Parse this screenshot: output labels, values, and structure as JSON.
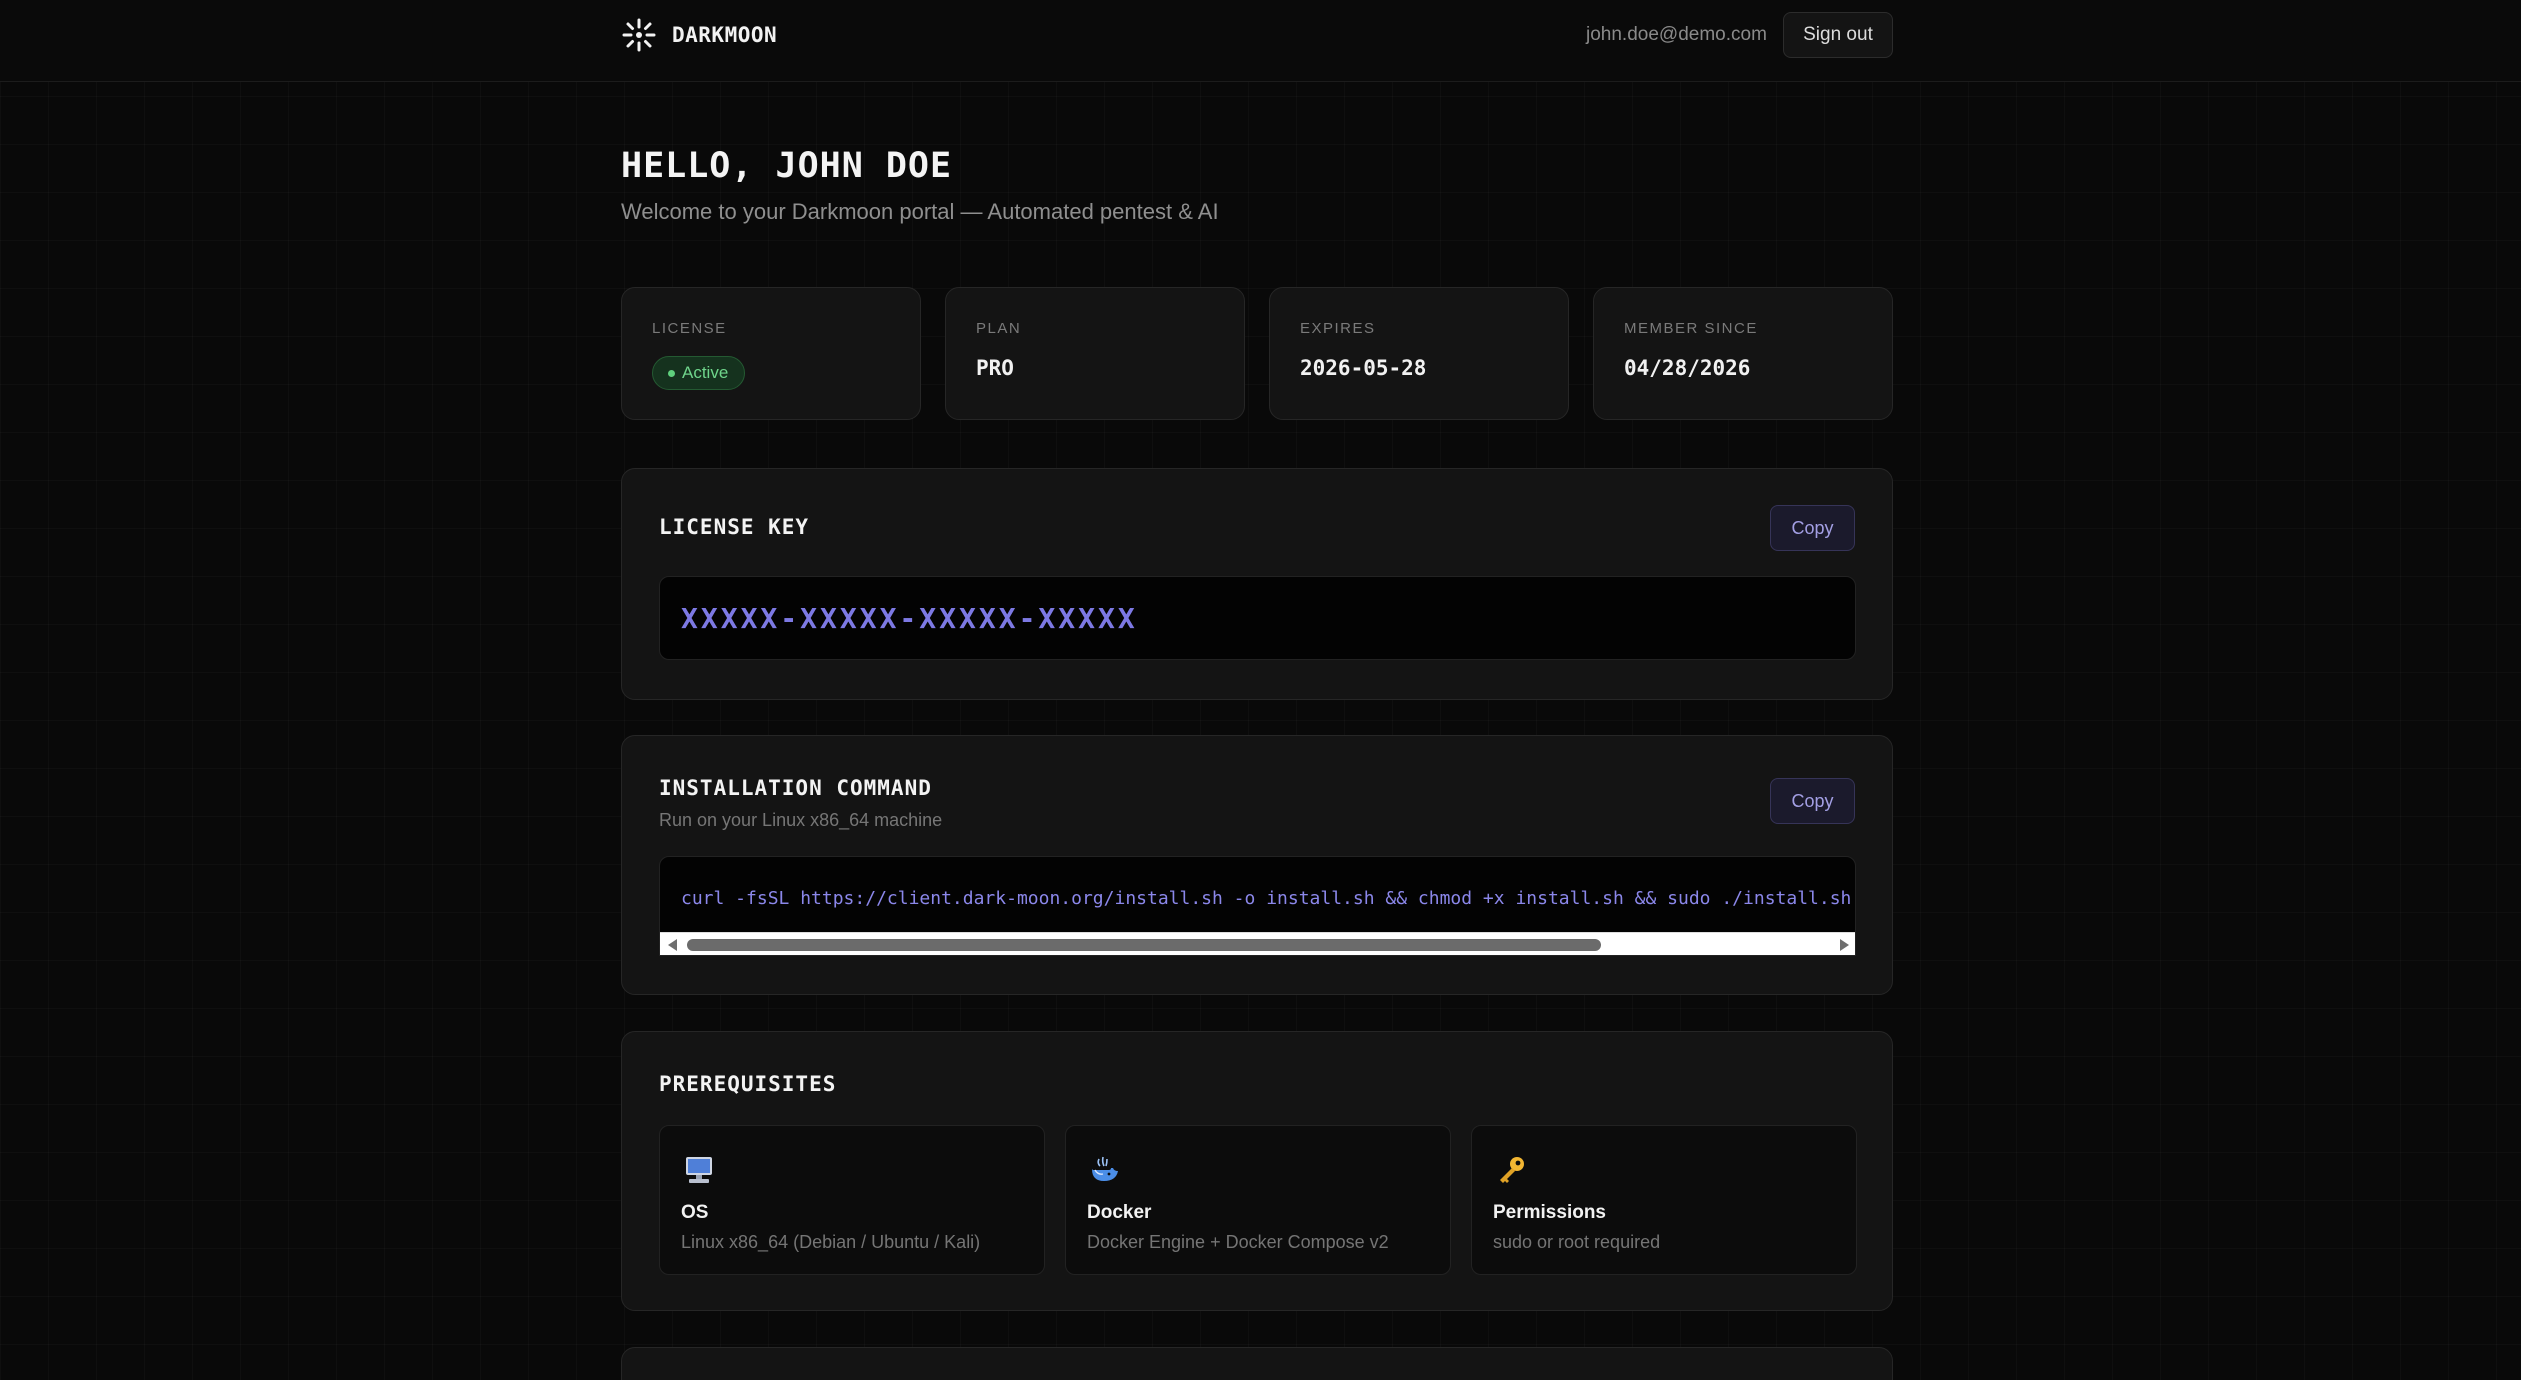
{
  "header": {
    "brand": "DARKMOON",
    "user_email": "john.doe@demo.com",
    "sign_out": "Sign out"
  },
  "greeting": {
    "title": "HELLO, JOHN DOE",
    "subtitle": "Welcome to your Darkmoon portal — Automated pentest & AI"
  },
  "stats": {
    "license": {
      "label": "LICENSE",
      "value": "Active",
      "status_color": "#5fd07d"
    },
    "plan": {
      "label": "PLAN",
      "value": "PRO"
    },
    "expires": {
      "label": "EXPIRES",
      "value": "2026-05-28"
    },
    "member_since": {
      "label": "MEMBER SINCE",
      "value": "04/28/2026"
    }
  },
  "license_key": {
    "title": "LICENSE KEY",
    "copy": "Copy",
    "value": "XXXXX-XXXXX-XXXXX-XXXXX"
  },
  "install": {
    "title": "INSTALLATION COMMAND",
    "subtitle": "Run on your Linux x86_64 machine",
    "copy": "Copy",
    "command": "curl -fsSL https://client.dark-moon.org/install.sh -o install.sh && chmod +x install.sh && sudo ./install.sh"
  },
  "prerequisites": {
    "title": "PREREQUISITES",
    "items": [
      {
        "icon": "computer-icon",
        "title": "OS",
        "desc": "Linux x86_64 (Debian / Ubuntu / Kali)"
      },
      {
        "icon": "docker-whale-icon",
        "title": "Docker",
        "desc": "Docker Engine + Docker Compose v2"
      },
      {
        "icon": "key-icon",
        "title": "Permissions",
        "desc": "sudo or root required"
      }
    ]
  },
  "colors": {
    "accent": "#7d79e4",
    "background": "#090909",
    "card": "#141414",
    "active_green": "#6fd58b"
  }
}
